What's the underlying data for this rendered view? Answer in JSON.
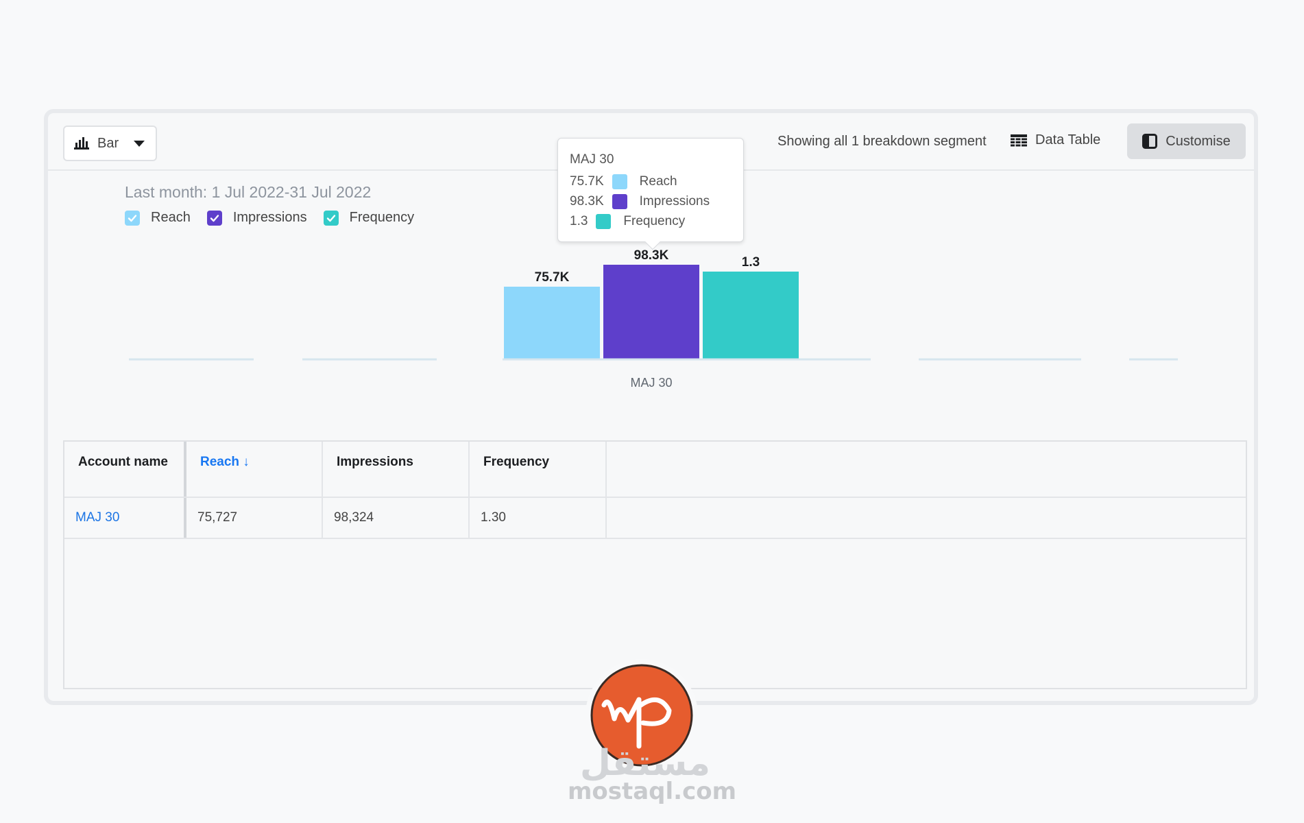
{
  "toolbar": {
    "chart_type_label": "Bar",
    "breakdown_text": "Showing all 1 breakdown segment",
    "data_table_label": "Data Table",
    "customise_label": "Customise"
  },
  "date_range": "Last month: 1 Jul 2022-31 Jul 2022",
  "legend": [
    {
      "label": "Reach",
      "color": "#8dd7fb"
    },
    {
      "label": "Impressions",
      "color": "#5e3fcb"
    },
    {
      "label": "Frequency",
      "color": "#33cbc8"
    }
  ],
  "tooltip": {
    "title": "MAJ 30",
    "rows": [
      {
        "value": "75.7K",
        "label": "Reach",
        "color": "#8dd7fb"
      },
      {
        "value": "98.3K",
        "label": "Impressions",
        "color": "#5e3fcb"
      },
      {
        "value": "1.3",
        "label": "Frequency",
        "color": "#33cbc8"
      }
    ]
  },
  "chart_data": {
    "type": "bar",
    "categories": [
      "MAJ 30"
    ],
    "series": [
      {
        "name": "Reach",
        "values": [
          75727
        ],
        "display": "75.7K",
        "color": "#8dd7fb",
        "scale_max": 98324
      },
      {
        "name": "Impressions",
        "values": [
          98324
        ],
        "display": "98.3K",
        "color": "#5e3fcb",
        "scale_max": 98324
      },
      {
        "name": "Frequency",
        "values": [
          1.3
        ],
        "display": "1.3",
        "color": "#33cbc8",
        "scale_max": 1.4
      }
    ],
    "title": "",
    "xlabel": "",
    "ylabel": "",
    "grid": false,
    "legend_position": "top-left"
  },
  "table": {
    "headers": [
      "Account name",
      "Reach ↓",
      "Impressions",
      "Frequency",
      ""
    ],
    "rows": [
      [
        "MAJ 30",
        "75,727",
        "98,324",
        "1.30",
        ""
      ]
    ]
  },
  "watermark": {
    "brand_text": "mostaql.com",
    "brand_arabic": "مستقل",
    "logo_color": "#e65c2e"
  }
}
